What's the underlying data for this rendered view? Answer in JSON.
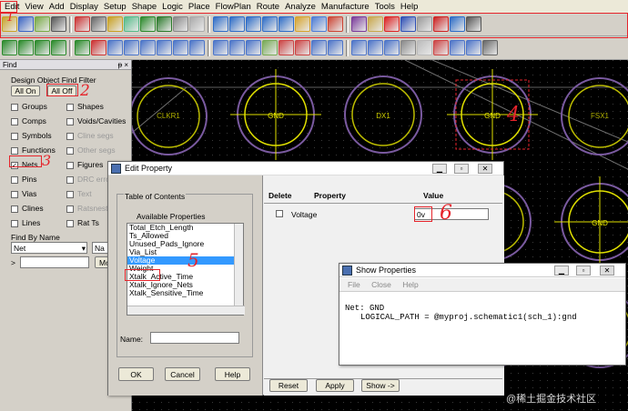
{
  "menu": [
    "Edit",
    "View",
    "Add",
    "Display",
    "Setup",
    "Shape",
    "Logic",
    "Place",
    "FlowPlan",
    "Route",
    "Analyze",
    "Manufacture",
    "Tools",
    "Help"
  ],
  "find": {
    "title": "Find",
    "filter_group": "Design Object Find Filter",
    "all_on": "All On",
    "all_off": "All Off",
    "left_items": [
      {
        "label": "Groups",
        "checked": false,
        "enabled": true
      },
      {
        "label": "Comps",
        "checked": false,
        "enabled": true
      },
      {
        "label": "Symbols",
        "checked": false,
        "enabled": true
      },
      {
        "label": "Functions",
        "checked": false,
        "enabled": true
      },
      {
        "label": "Nets",
        "checked": true,
        "enabled": true
      },
      {
        "label": "Pins",
        "checked": false,
        "enabled": true
      },
      {
        "label": "Vias",
        "checked": false,
        "enabled": true
      },
      {
        "label": "Clines",
        "checked": false,
        "enabled": true
      },
      {
        "label": "Lines",
        "checked": false,
        "enabled": true
      }
    ],
    "right_items": [
      {
        "label": "Shapes",
        "checked": false,
        "enabled": true
      },
      {
        "label": "Voids/Cavities",
        "checked": false,
        "enabled": true
      },
      {
        "label": "Cline segs",
        "checked": false,
        "enabled": false
      },
      {
        "label": "Other segs",
        "checked": false,
        "enabled": false
      },
      {
        "label": "Figures",
        "checked": false,
        "enabled": true
      },
      {
        "label": "DRC erro",
        "checked": false,
        "enabled": false
      },
      {
        "label": "Text",
        "checked": false,
        "enabled": false
      },
      {
        "label": "Ratsnest",
        "checked": false,
        "enabled": false
      },
      {
        "label": "Rat Ts",
        "checked": false,
        "enabled": true
      }
    ],
    "find_by_name": "Find By Name",
    "type_value": "Net",
    "name_value": "Na",
    "more_label": "Mo",
    "arrow": ">"
  },
  "canvas": {
    "labels": [
      "CLKR1",
      "GND",
      "DX1",
      "GND",
      "FSX1",
      "GND"
    ]
  },
  "edit_property": {
    "title": "Edit Property",
    "toc_group": "Table of Contents",
    "available_label": "Available Properties",
    "properties": [
      "Total_Etch_Length",
      "Ts_Allowed",
      "Unused_Pads_Ignore",
      "Via_List",
      "Voltage",
      "Weight",
      "Xtalk_Active_Time",
      "Xtalk_Ignore_Nets",
      "Xtalk_Sensitive_Time"
    ],
    "selected_index": 4,
    "name_label": "Name:",
    "ok": "OK",
    "cancel": "Cancel",
    "help": "Help",
    "col_delete": "Delete",
    "col_property": "Property",
    "col_value": "Value",
    "row_property": "Voltage",
    "row_value": "0v",
    "reset": "Reset",
    "apply": "Apply",
    "show": "Show ->"
  },
  "show_properties": {
    "title": "Show Properties",
    "menu": [
      "File",
      "Close",
      "Help"
    ],
    "line1": "Net: GND",
    "line2": "LOGICAL_PATH = @myproj.schematic1(sch_1):gnd"
  },
  "annotations": [
    "1",
    "2",
    "3",
    "4",
    "5",
    "6"
  ],
  "watermark": "@稀土掘金技术社区",
  "colors": {
    "annotation": "#e5242b",
    "selection": "#3399ff",
    "pad_ring": "#d8d800",
    "pad_label": "#e8e800"
  }
}
